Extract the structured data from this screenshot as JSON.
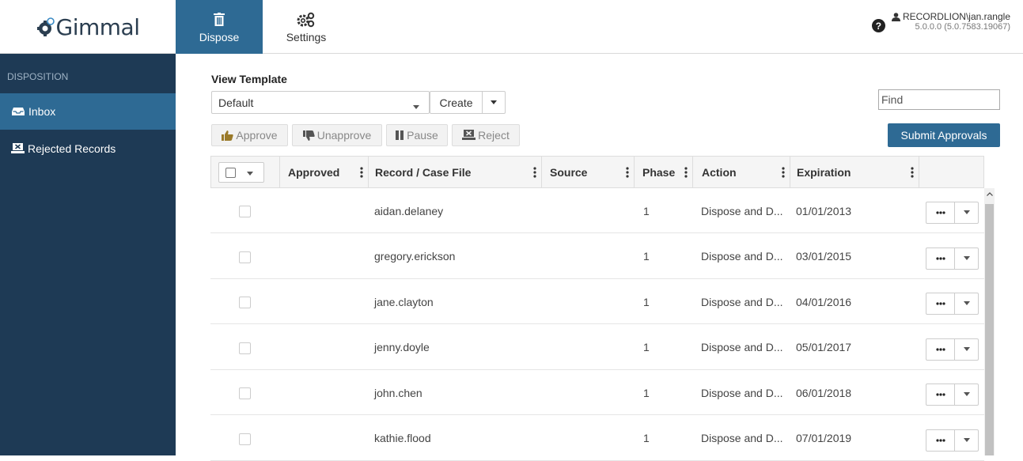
{
  "header": {
    "logo_text": "Gimmal",
    "tabs": [
      {
        "label": "Dispose",
        "icon": "trash-icon",
        "active": true
      },
      {
        "label": "Settings",
        "icon": "gears-icon",
        "active": false
      }
    ],
    "user": "RECORDLION\\jan.rangle",
    "version": "5.0.0.0 (5.0.7583.19067)"
  },
  "sidebar": {
    "heading": "DISPOSITION",
    "items": [
      {
        "label": "Inbox",
        "icon": "inbox-icon",
        "active": true
      },
      {
        "label": "Rejected Records",
        "icon": "reject-icon",
        "active": false
      }
    ]
  },
  "toolbar": {
    "view_template_label": "View Template",
    "template_value": "Default",
    "create_label": "Create",
    "find_placeholder": "Find",
    "approve_label": "Approve",
    "unapprove_label": "Unapprove",
    "pause_label": "Pause",
    "reject_label": "Reject",
    "submit_label": "Submit Approvals"
  },
  "grid": {
    "columns": [
      "Approved",
      "Record / Case File",
      "Source",
      "Phase",
      "Action",
      "Expiration"
    ],
    "rows": [
      {
        "record": "aidan.delaney",
        "phase": "1",
        "action": "Dispose and D...",
        "expiration": "01/01/2013"
      },
      {
        "record": "gregory.erickson",
        "phase": "1",
        "action": "Dispose and D...",
        "expiration": "03/01/2015"
      },
      {
        "record": "jane.clayton",
        "phase": "1",
        "action": "Dispose and D...",
        "expiration": "04/01/2016"
      },
      {
        "record": "jenny.doyle",
        "phase": "1",
        "action": "Dispose and D...",
        "expiration": "05/01/2017"
      },
      {
        "record": "john.chen",
        "phase": "1",
        "action": "Dispose and D...",
        "expiration": "06/01/2018"
      },
      {
        "record": "kathie.flood",
        "phase": "1",
        "action": "Dispose and D...",
        "expiration": "07/01/2019"
      }
    ]
  },
  "colors": {
    "accent": "#2e6a94",
    "sidebar_bg": "#1e3a55"
  }
}
